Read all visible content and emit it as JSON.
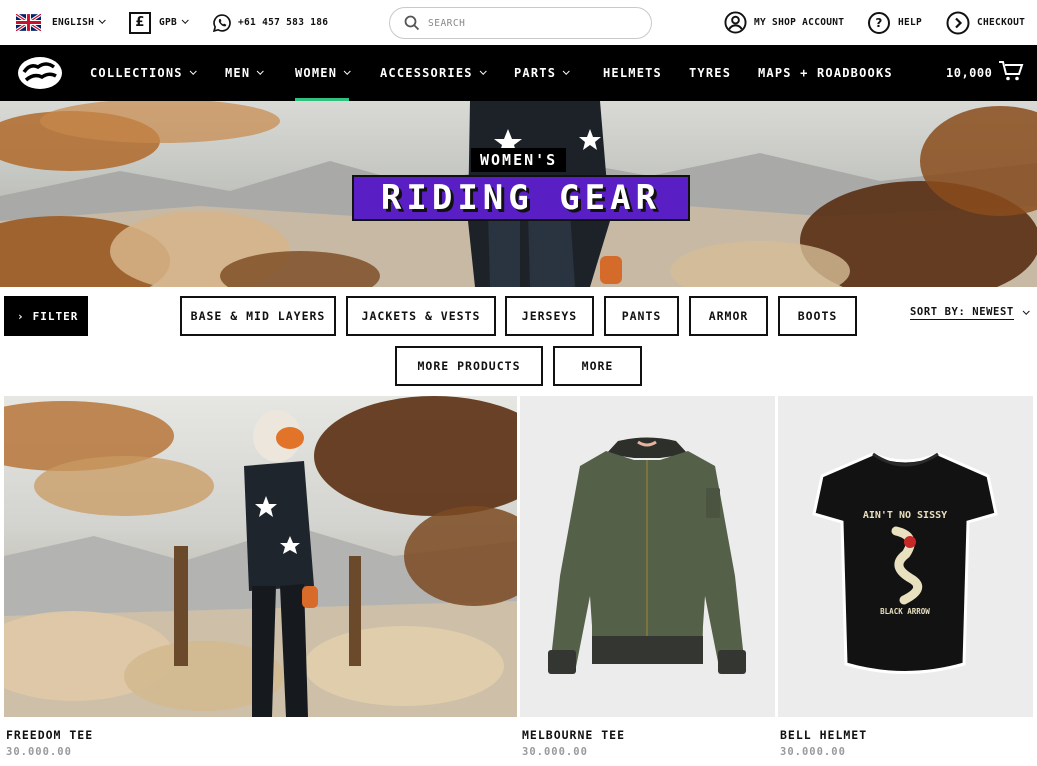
{
  "topbar": {
    "language": "ENGLISH",
    "currency_symbol": "£",
    "currency": "GPB",
    "phone": "+61 457 583 186",
    "search_placeholder": "SEARCH",
    "account": "MY SHOP ACCOUNT",
    "help": "HELP",
    "checkout": "CHECKOUT",
    "icons": [
      "uk-flag-icon",
      "pound-icon",
      "whatsapp-icon",
      "search-icon",
      "user-icon",
      "question-icon",
      "arrow-right-icon"
    ]
  },
  "nav": {
    "items": [
      {
        "label": "COLLECTIONS",
        "dropdown": true
      },
      {
        "label": "MEN",
        "dropdown": true
      },
      {
        "label": "WOMEN",
        "dropdown": true,
        "active": true
      },
      {
        "label": "ACCESSORIES",
        "dropdown": true
      },
      {
        "label": "PARTS",
        "dropdown": true
      },
      {
        "label": "HELMETS",
        "dropdown": false
      },
      {
        "label": "TYRES",
        "dropdown": false
      },
      {
        "label": "MAPS + ROADBOOKS",
        "dropdown": false
      }
    ],
    "cart_total": "10,000",
    "active_color": "#2ec27e"
  },
  "hero": {
    "subtitle": "WOMEN'S",
    "title": "RIDING GEAR",
    "title_bg": "#5a1fc4"
  },
  "filters": {
    "filter_label": "FILTER",
    "categories": [
      "BASE & MID LAYERS",
      "JACKETS & VESTS",
      "JERSEYS",
      "PANTS",
      "ARMOR",
      "BOOTS",
      "MORE PRODUCTS",
      "MORE"
    ],
    "sort_label": "SORT BY: NEWEST"
  },
  "products": [
    {
      "name": "FREEDOM TEE",
      "price": "30.000.00"
    },
    {
      "name": "MELBOURNE TEE",
      "price": "30.000.00"
    },
    {
      "name": "BELL HELMET",
      "price": "30.000.00",
      "print_text_top": "AIN'T NO SISSY",
      "print_text_bottom": "BLACK ARROW"
    }
  ]
}
